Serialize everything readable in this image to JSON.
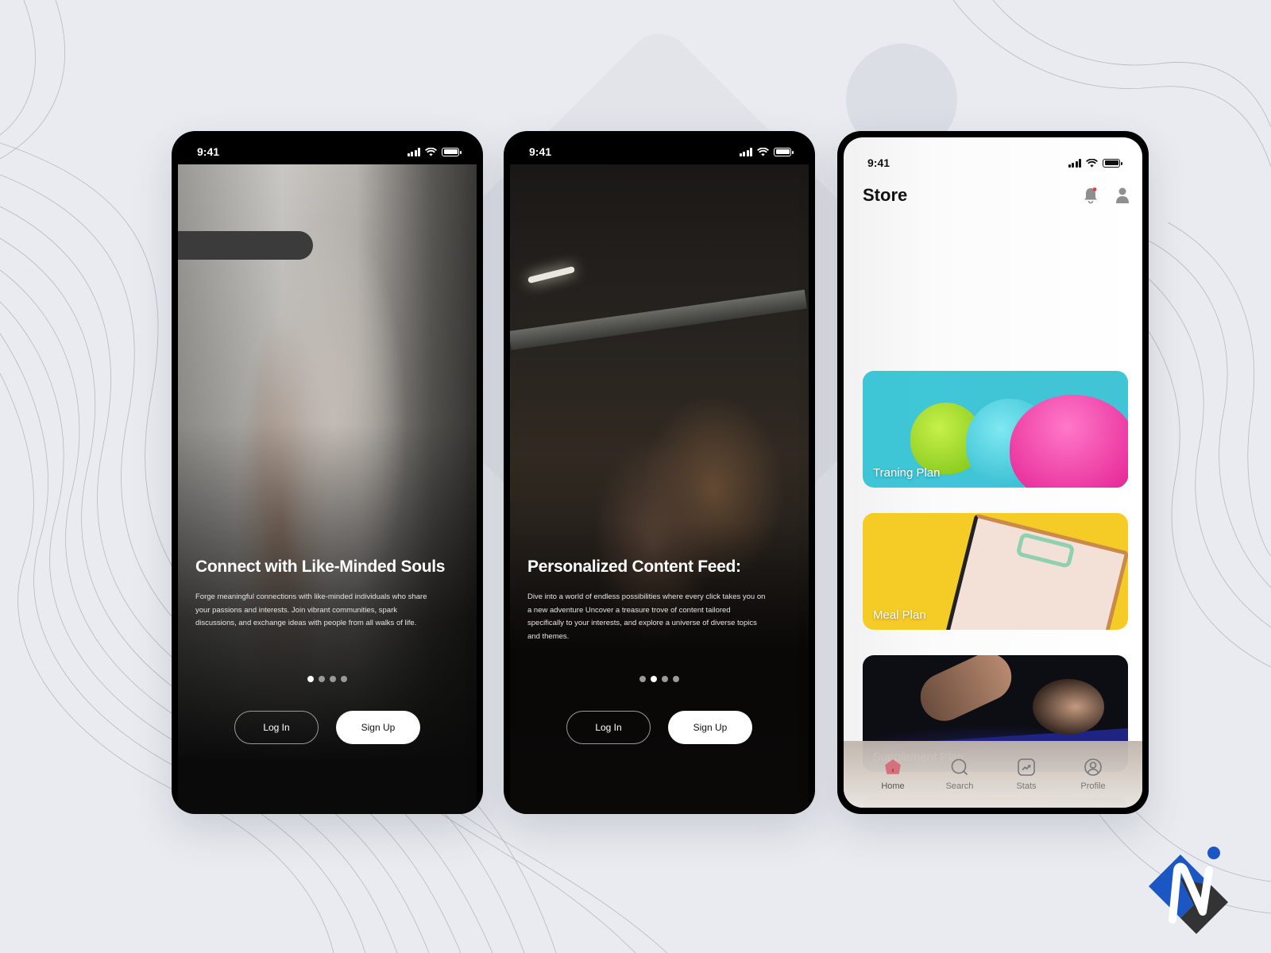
{
  "status_bar": {
    "time": "9:41"
  },
  "onboarding": [
    {
      "title": "Connect with Like-Minded Souls",
      "description": "Forge meaningful connections with like-minded individuals who share your passions and interests. Join vibrant communities, spark discussions, and exchange ideas with people from all walks of life.",
      "page_count": 4,
      "active_page": 1,
      "login_label": "Log In",
      "signup_label": "Sign Up"
    },
    {
      "title": "Personalized Content Feed:",
      "description": "Dive into a world of endless possibilities where every click takes you on a new adventure Uncover a treasure trove of content tailored specifically to your interests, and explore a universe of diverse topics and themes.",
      "page_count": 4,
      "active_page": 2,
      "login_label": "Log In",
      "signup_label": "Sign Up"
    }
  ],
  "store": {
    "title": "Store",
    "icons": [
      "bell-icon",
      "user-icon"
    ],
    "notification_dot_color": "#f03a3a",
    "cards": [
      {
        "label": "Traning Plan"
      },
      {
        "label": "Meal Plan"
      },
      {
        "label": "Supplement Plan"
      },
      {
        "label": ""
      }
    ],
    "tabbar": [
      {
        "label": "Home",
        "icon": "home-icon",
        "active": true
      },
      {
        "label": "Search",
        "icon": "search-icon",
        "active": false
      },
      {
        "label": "Stats",
        "icon": "stats-icon",
        "active": false
      },
      {
        "label": "Profile",
        "icon": "profile-icon",
        "active": false
      }
    ],
    "accent_color": "#d6707a"
  },
  "brand": {
    "logo": "N-logo",
    "colors": [
      "#1a56c4",
      "#333333",
      "#ffffff"
    ]
  }
}
